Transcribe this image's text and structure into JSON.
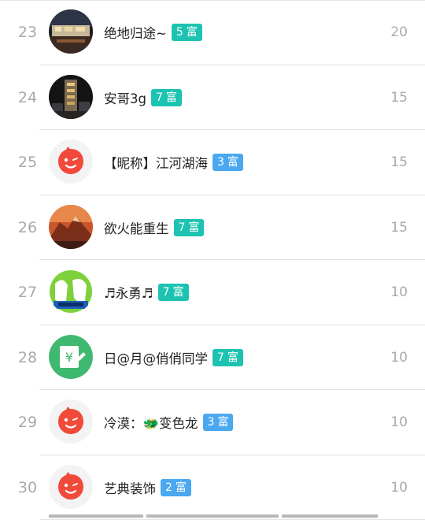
{
  "colors": {
    "badge_teal": "#1cc3b0",
    "badge_blue": "#4aa8f0",
    "rank_gray": "#a9a9a9",
    "text": "#222222",
    "divider": "#e3e3e3"
  },
  "badge_suffix": "富",
  "rows": [
    {
      "rank": "23",
      "name": "绝地归途~",
      "level": "5",
      "badge_color": "teal",
      "score": "20",
      "avatar": "city-night-photo"
    },
    {
      "rank": "24",
      "name": "安哥3g",
      "level": "7",
      "badge_color": "teal",
      "score": "15",
      "avatar": "tower-night-photo"
    },
    {
      "rank": "25",
      "name": "【昵称】江河湖海",
      "level": "3",
      "badge_color": "blue",
      "score": "15",
      "avatar": "default-red-face"
    },
    {
      "rank": "26",
      "name": "欲火能重生",
      "level": "7",
      "badge_color": "teal",
      "score": "15",
      "avatar": "mountain-sunset-photo"
    },
    {
      "rank": "27",
      "name": "♬永勇♬",
      "level": "7",
      "badge_color": "teal",
      "score": "10",
      "avatar": "green-logo"
    },
    {
      "rank": "28",
      "name": "日@月@俏俏同学",
      "level": "7",
      "badge_color": "teal",
      "score": "10",
      "avatar": "green-yen-app-icon"
    },
    {
      "rank": "29",
      "name": "冷漠：🐲变色龙",
      "level": "3",
      "badge_color": "blue",
      "score": "10",
      "avatar": "default-red-face"
    },
    {
      "rank": "30",
      "name": "艺典装饰",
      "level": "2",
      "badge_color": "blue",
      "score": "10",
      "avatar": "default-red-face"
    }
  ]
}
